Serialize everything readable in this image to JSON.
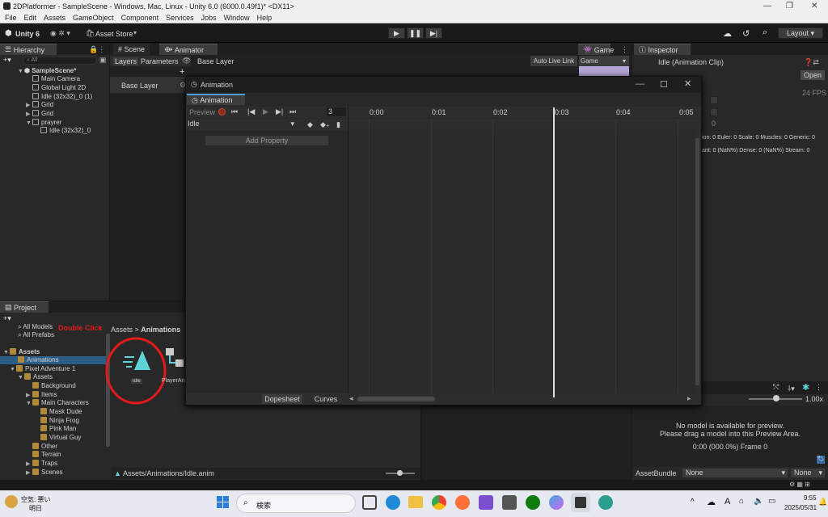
{
  "window": {
    "title": "2DPlatformer - SampleScene - Windows, Mac, Linux - Unity 6.0 (6000.0.49f1)* <DX11>"
  },
  "menu": [
    "File",
    "Edit",
    "Assets",
    "GameObject",
    "Component",
    "Services",
    "Jobs",
    "Window",
    "Help"
  ],
  "toolbar": {
    "account": "Unity 6",
    "asset_store": "Asset Store",
    "layout": "Layout"
  },
  "hierarchy": {
    "tab": "Hierarchy",
    "search_placeholder": "All",
    "scene": "SampleScene*",
    "items": [
      "Main Camera",
      "Global Light 2D",
      "Idle (32x32)_0 (1)",
      "Grid",
      "Grid",
      "prayrer",
      "Idle (32x32)_0"
    ]
  },
  "scene_tabs": {
    "scene": "Scene",
    "animator": "Animator",
    "game": "Game",
    "game_dropdown": "Game"
  },
  "animator": {
    "layers": "Layers",
    "parameters": "Parameters",
    "base_layer_crumb": "Base Layer",
    "auto_live_link": "Auto Live Link",
    "base_layer": "Base Layer"
  },
  "inspector": {
    "tab": "Inspector",
    "clip_title": "Idle (Animation Clip)",
    "open": "Open",
    "fps": "24 FPS",
    "value": "0",
    "stats1": "ion: 0 Euler: 0 Scale: 0 Muscles: 0 Generic: 0",
    "stats2": "ant: 0 (NaN%) Dense: 0 (NaN%) Stream: 0",
    "zoom": "1.00x",
    "no_model_1": "No model is available for preview.",
    "no_model_2": "Please drag a model into this Preview Area.",
    "time": "0:00 (000.0%) Frame 0",
    "assetbundle": "AssetBundle",
    "none1": "None",
    "none2": "None"
  },
  "animation_window": {
    "title": "Animation",
    "tab": "Animation",
    "preview": "Preview",
    "frame": "3",
    "clip": "Idle",
    "add_property": "Add Property",
    "dopesheet": "Dopesheet",
    "curves": "Curves",
    "ticks": [
      "0:00",
      "0:01",
      "0:02",
      "0:03",
      "0:04",
      "0:05"
    ]
  },
  "project": {
    "tab": "Project",
    "favorites": [
      "All Models",
      "All Prefabs"
    ],
    "annotation": "Double Click",
    "assets": "Assets",
    "tree": [
      "Animations",
      "Pixel Adventure 1",
      "Assets",
      "Background",
      "Items",
      "Main Characters",
      "Mask Dude",
      "Ninja Frog",
      "Pink Man",
      "Virtual Guy",
      "Other",
      "Terrain",
      "Traps",
      "Scenes"
    ],
    "breadcrumb_assets": "Assets",
    "breadcrumb_folder": "Animations",
    "asset_idle": "Idle",
    "asset_player": "PlayerAni",
    "path": "Assets/Animations/Idle.anim"
  },
  "taskbar": {
    "weather_1": "空気: 悪い",
    "weather_2": "明日",
    "search": "検索",
    "time": "9:55",
    "date": "2025/05/31",
    "ime": "A"
  },
  "colors": {
    "accent": "#4a9dd9",
    "annotation": "#e31b1b",
    "anim_icon": "#5fd4d8",
    "record": "#c84c2a"
  }
}
